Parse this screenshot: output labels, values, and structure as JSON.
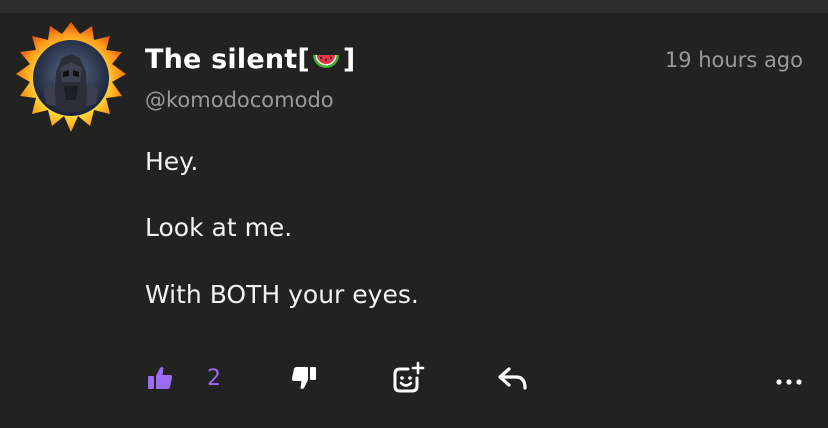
{
  "post": {
    "author_name": "The silent[",
    "author_name_suffix": " ]",
    "author_emoji": "watermelon-icon",
    "handle": "@komodocomodo",
    "timestamp": "19 hours ago",
    "lines": [
      "Hey.",
      "Look at me.",
      "With BOTH your eyes."
    ]
  },
  "actions": {
    "like_count": "2",
    "like_icon": "thumbs-up-icon",
    "dislike_icon": "thumbs-down-icon",
    "react_icon": "add-reaction-icon",
    "reply_icon": "reply-icon",
    "more_icon": "more-options-icon"
  },
  "colors": {
    "background": "#222320",
    "accent": "#9b6cf0",
    "muted_text": "#9a9b97"
  }
}
